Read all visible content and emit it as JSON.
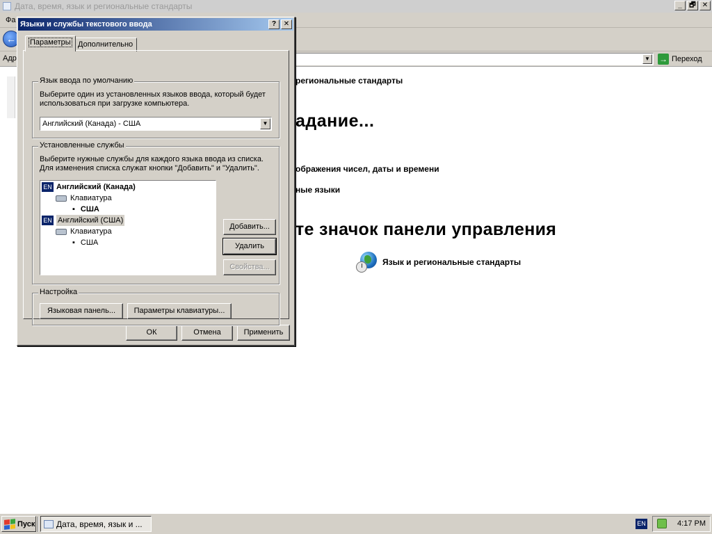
{
  "background_window": {
    "title": "Дата, время, язык и региональные стандарты",
    "menu_fragment": "Фа",
    "address_label": "Адр",
    "go_label": "Переход",
    "crumb": "региональные стандарты",
    "task_heading": "адание...",
    "task1": "ображения чисел, даты и времени",
    "task2": "ные языки",
    "icon_heading": "те значок панели управления",
    "icon_label": "Язык и региональные стандарты"
  },
  "dialog": {
    "title": "Языки и службы текстового ввода",
    "help_btn": "?",
    "close_btn": "✕",
    "tabs": [
      "Параметры",
      "Дополнительно"
    ],
    "default_group": {
      "title": "Язык ввода по умолчанию",
      "desc_line1": "Выберите один из установленных языков ввода, который будет",
      "desc_line2": "использоваться при загрузке компьютера.",
      "selected": "Английский (Канада) - США"
    },
    "services_group": {
      "title": "Установленные службы",
      "desc_line1": "Выберите нужные службы для каждого языка ввода из списка.",
      "desc_line2": "Для изменения списка служат кнопки \"Добавить\" и \"Удалить\".",
      "tree": {
        "lang1_badge": "EN",
        "lang1": "Английский (Канада)",
        "lang1_category": "Клавиатура",
        "lang1_layout": "США",
        "lang2_badge": "EN",
        "lang2": "Английский (США)",
        "lang2_category": "Клавиатура",
        "lang2_layout": "США"
      },
      "add_btn": "Добавить...",
      "remove_btn": "Удалить",
      "props_btn": "Свойства..."
    },
    "prefs_group": {
      "title": "Настройка",
      "langbar_btn": "Языковая панель...",
      "keys_btn": "Параметры клавиатуры..."
    },
    "ok_btn": "ОК",
    "cancel_btn": "Отмена",
    "apply_btn": "Применить"
  },
  "taskbar": {
    "start_label": "Пуск",
    "task_label": "Дата, время, язык и ...",
    "lang_indicator": "EN",
    "clock": "4:17 PM"
  },
  "icons": {
    "window_controls": [
      "_",
      "🗗",
      "✕"
    ],
    "back": "←",
    "go": "→",
    "dropdown": "▼"
  }
}
